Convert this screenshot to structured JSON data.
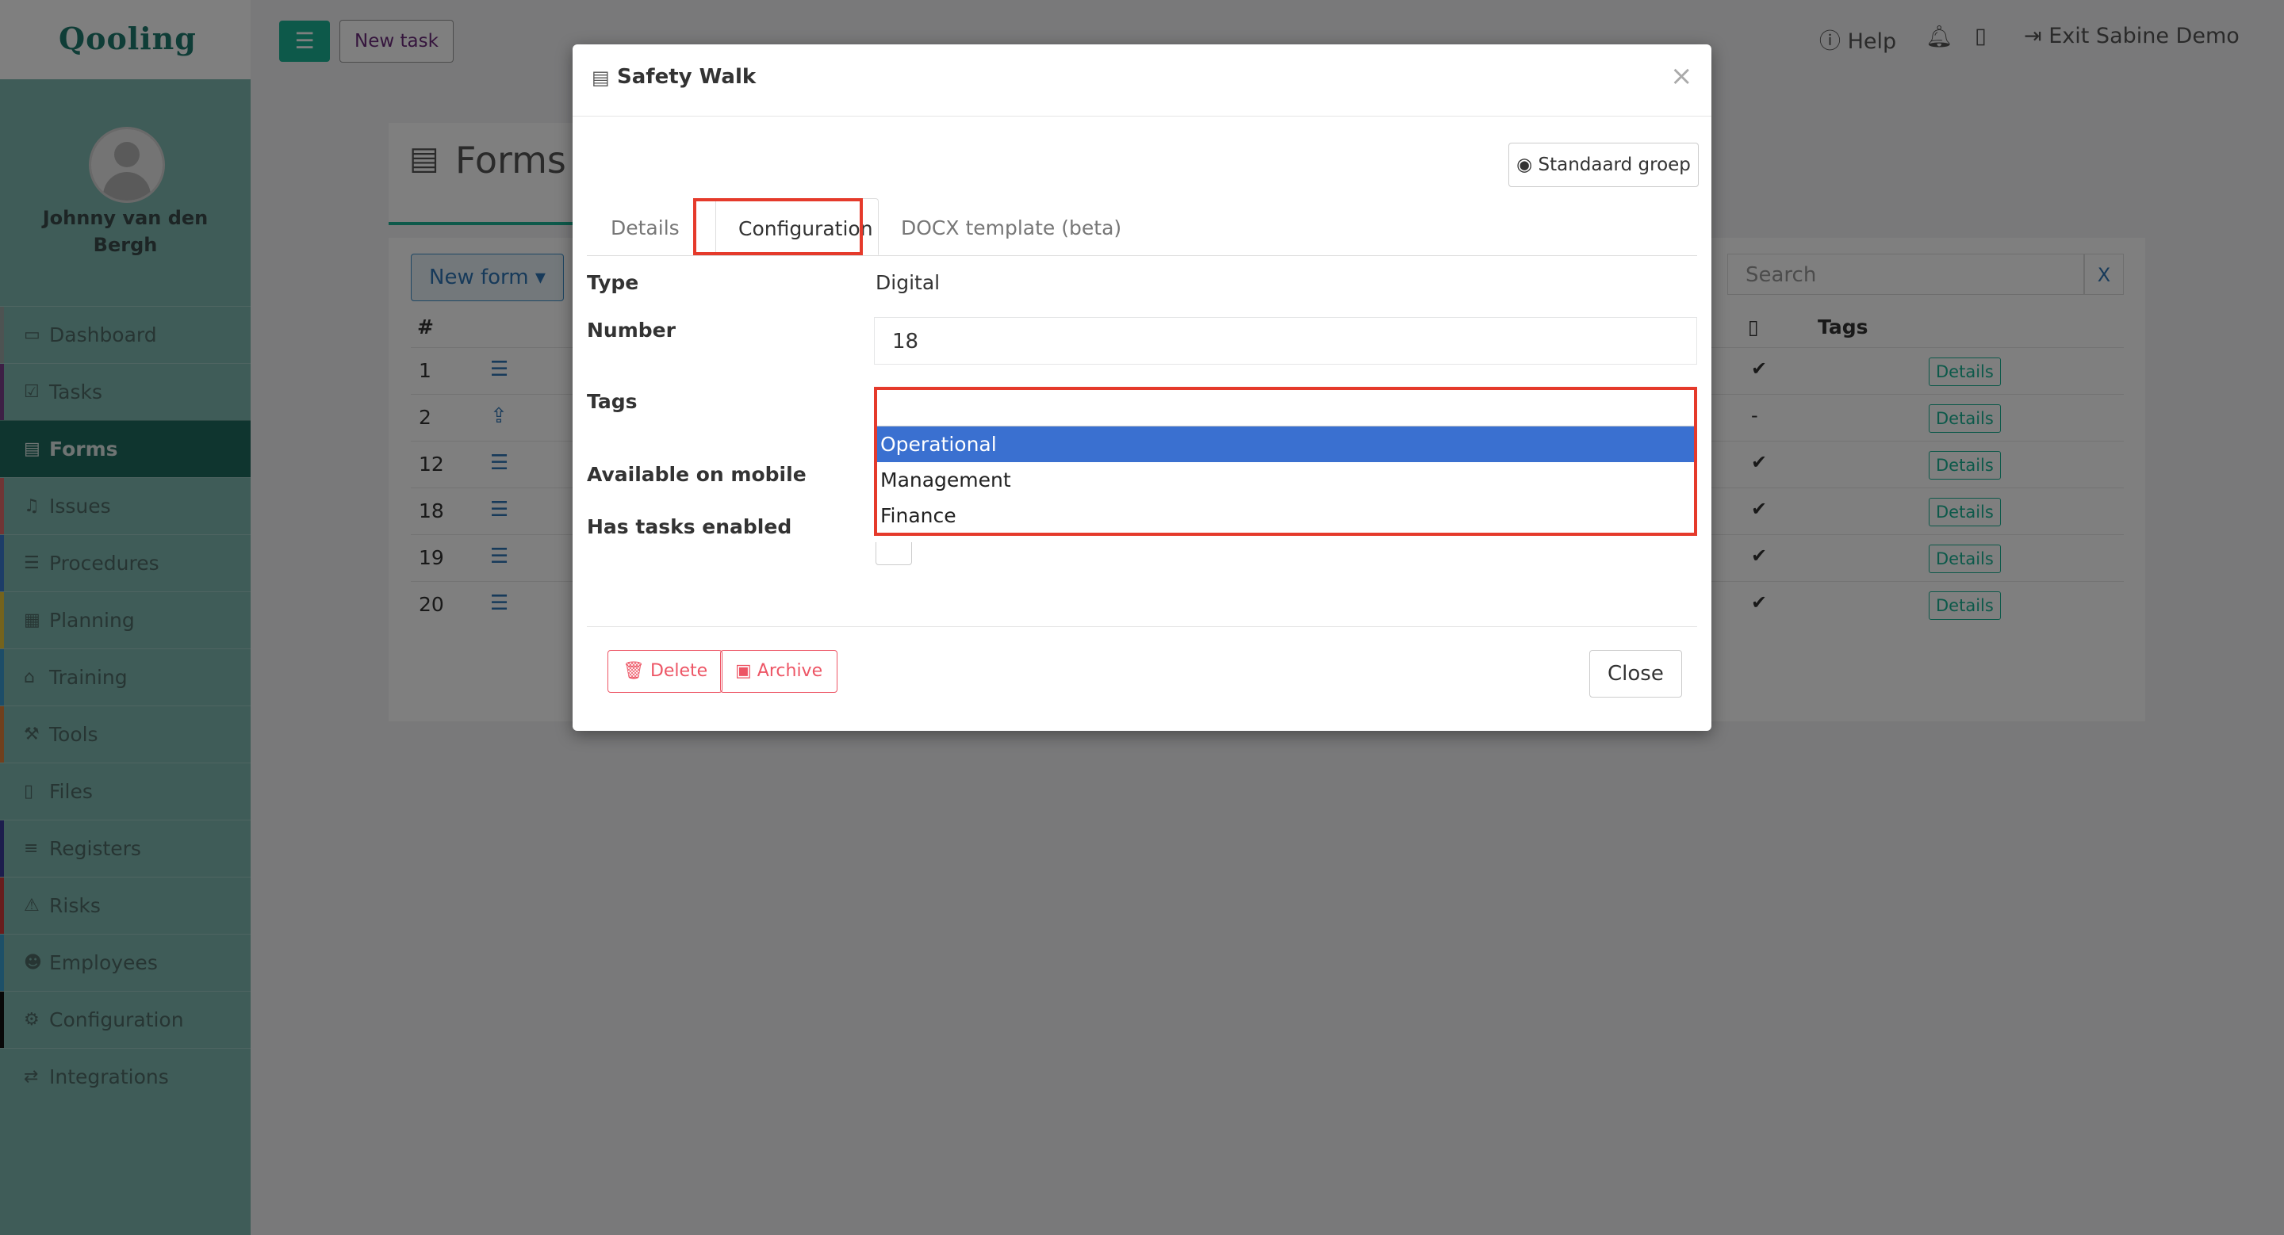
{
  "app": {
    "logo": "Qooling"
  },
  "sidebar": {
    "user_name": "Johnny van den Bergh",
    "items": [
      {
        "label": "Dashboard",
        "icon": "monitor-icon",
        "accent": "#9aa6a5"
      },
      {
        "label": "Tasks",
        "icon": "checkbox-icon",
        "accent": "#7b3f8a"
      },
      {
        "label": "Forms",
        "icon": "document-icon",
        "accent": "#1f6b5e"
      },
      {
        "label": "Issues",
        "icon": "bell-icon",
        "accent": "#e06a6a"
      },
      {
        "label": "Procedures",
        "icon": "list-icon",
        "accent": "#3a7ad0"
      },
      {
        "label": "Planning",
        "icon": "calendar-icon",
        "accent": "#e8c63a"
      },
      {
        "label": "Training",
        "icon": "graduation-cap-icon",
        "accent": "#3a9ad0"
      },
      {
        "label": "Tools",
        "icon": "wrench-icon",
        "accent": "#e0813a"
      },
      {
        "label": "Files",
        "icon": "file-icon",
        "accent": "#7fb8b0"
      },
      {
        "label": "Registers",
        "icon": "lines-icon",
        "accent": "#3a3a9a"
      },
      {
        "label": "Risks",
        "icon": "warning-icon",
        "accent": "#d03a3a"
      },
      {
        "label": "Employees",
        "icon": "users-icon",
        "accent": "#3aa0d0"
      },
      {
        "label": "Configuration",
        "icon": "gear-icon",
        "accent": "#111111"
      },
      {
        "label": "Integrations",
        "icon": "exchange-icon",
        "accent": "#7fb8b0"
      }
    ]
  },
  "topbar": {
    "new_task_label": "New task",
    "help_label": "Help",
    "exit_label": "Exit Sabine Demo"
  },
  "page": {
    "title": "Forms",
    "new_form_label": "New form",
    "search_placeholder": "Search",
    "search_clear": "X",
    "table": {
      "col_number": "#",
      "col_tags": "Tags",
      "rows": [
        {
          "number": "1",
          "mobile": "✔",
          "details": "Details"
        },
        {
          "number": "2",
          "mobile": "-",
          "details": "Details"
        },
        {
          "number": "12",
          "mobile": "✔",
          "details": "Details"
        },
        {
          "number": "18",
          "mobile": "✔",
          "details": "Details"
        },
        {
          "number": "19",
          "mobile": "✔",
          "details": "Details"
        },
        {
          "number": "20",
          "mobile": "✔",
          "details": "Details"
        }
      ]
    }
  },
  "modal": {
    "title": "Safety Walk",
    "close_x": "×",
    "group_label": "Standaard groep",
    "tabs": [
      {
        "label": "Details"
      },
      {
        "label": "Configuration"
      },
      {
        "label": "DOCX template (beta)"
      }
    ],
    "fields": {
      "type_label": "Type",
      "type_value": "Digital",
      "number_label": "Number",
      "number_value": "18",
      "tags_label": "Tags",
      "mobile_label": "Available on mobile",
      "tasks_label": "Has tasks enabled"
    },
    "tag_options": [
      {
        "label": "Operational",
        "selected": true
      },
      {
        "label": "Management",
        "selected": false
      },
      {
        "label": "Finance",
        "selected": false
      }
    ],
    "delete_label": "Delete",
    "archive_label": "Archive",
    "close_label": "Close"
  },
  "colors": {
    "accent": "#1ab394",
    "highlight": "#e53a2b",
    "selected_option": "#3a70d0",
    "danger": "#ed5565"
  }
}
